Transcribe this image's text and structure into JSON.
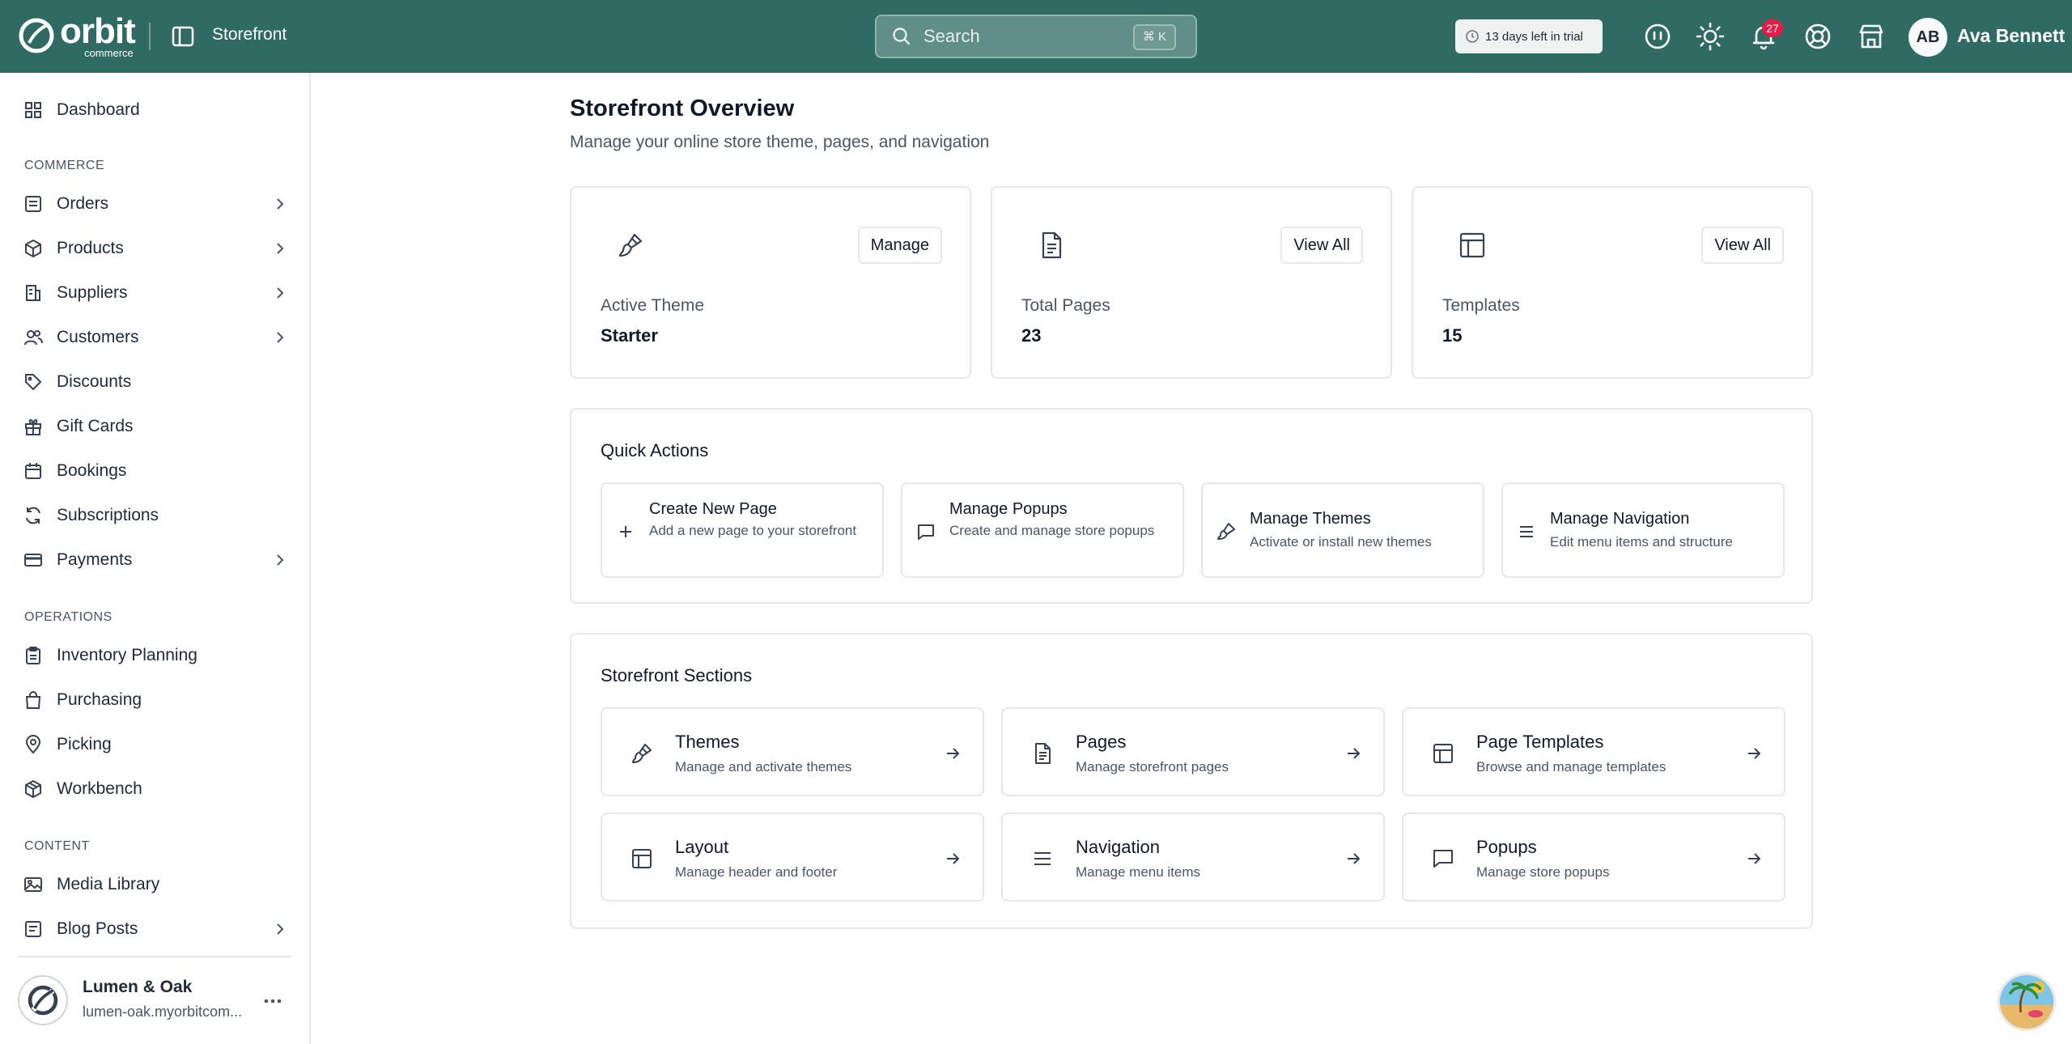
{
  "app": {
    "logo_text": "orbit",
    "logo_sub": "commerce",
    "breadcrumb": "Storefront"
  },
  "search": {
    "placeholder": "Search",
    "shortcut": "⌘ K"
  },
  "trial": {
    "label": "13 days left in trial"
  },
  "notifications": {
    "count": "27"
  },
  "user": {
    "initials": "AB",
    "name": "Ava Bennett"
  },
  "colors": {
    "topbar": "#2f6b62",
    "badge": "#e11d48"
  },
  "sidebar": {
    "dashboard": "Dashboard",
    "sections": [
      {
        "label": "COMMERCE",
        "items": [
          "Orders",
          "Products",
          "Suppliers",
          "Customers",
          "Discounts",
          "Gift Cards",
          "Bookings",
          "Subscriptions",
          "Payments"
        ]
      },
      {
        "label": "OPERATIONS",
        "items": [
          "Inventory Planning",
          "Purchasing",
          "Picking",
          "Workbench"
        ]
      },
      {
        "label": "CONTENT",
        "items": [
          "Media Library",
          "Blog Posts"
        ]
      }
    ],
    "commerce": {
      "label": "COMMERCE",
      "orders": "Orders",
      "products": "Products",
      "suppliers": "Suppliers",
      "customers": "Customers",
      "discounts": "Discounts",
      "gift_cards": "Gift Cards",
      "bookings": "Bookings",
      "subscriptions": "Subscriptions",
      "payments": "Payments"
    },
    "operations": {
      "label": "OPERATIONS",
      "inventory": "Inventory Planning",
      "purchasing": "Purchasing",
      "picking": "Picking",
      "workbench": "Workbench"
    },
    "content": {
      "label": "CONTENT",
      "media": "Media Library",
      "blog": "Blog Posts"
    },
    "store": {
      "name": "Lumen & Oak",
      "url": "lumen-oak.myorbitcom..."
    }
  },
  "page": {
    "title": "Storefront Overview",
    "subtitle": "Manage your online store theme, pages, and navigation"
  },
  "stats": {
    "theme": {
      "label": "Active Theme",
      "value": "Starter",
      "button": "Manage"
    },
    "pages": {
      "label": "Total Pages",
      "value": "23",
      "button": "View All"
    },
    "templates": {
      "label": "Templates",
      "value": "15",
      "button": "View All"
    }
  },
  "quick_actions": {
    "title": "Quick Actions",
    "create_page": {
      "title": "Create New Page",
      "desc": "Add a new page to your storefront"
    },
    "popups": {
      "title": "Manage Popups",
      "desc": "Create and manage store popups"
    },
    "themes": {
      "title": "Manage Themes",
      "desc": "Activate or install new themes"
    },
    "navigation": {
      "title": "Manage Navigation",
      "desc": "Edit menu items and structure"
    }
  },
  "sections": {
    "title": "Storefront Sections",
    "themes": {
      "title": "Themes",
      "desc": "Manage and activate themes"
    },
    "pages": {
      "title": "Pages",
      "desc": "Manage storefront pages"
    },
    "templates": {
      "title": "Page Templates",
      "desc": "Browse and manage templates"
    },
    "layout": {
      "title": "Layout",
      "desc": "Manage header and footer"
    },
    "navigation": {
      "title": "Navigation",
      "desc": "Manage menu items"
    },
    "popups": {
      "title": "Popups",
      "desc": "Manage store popups"
    }
  }
}
